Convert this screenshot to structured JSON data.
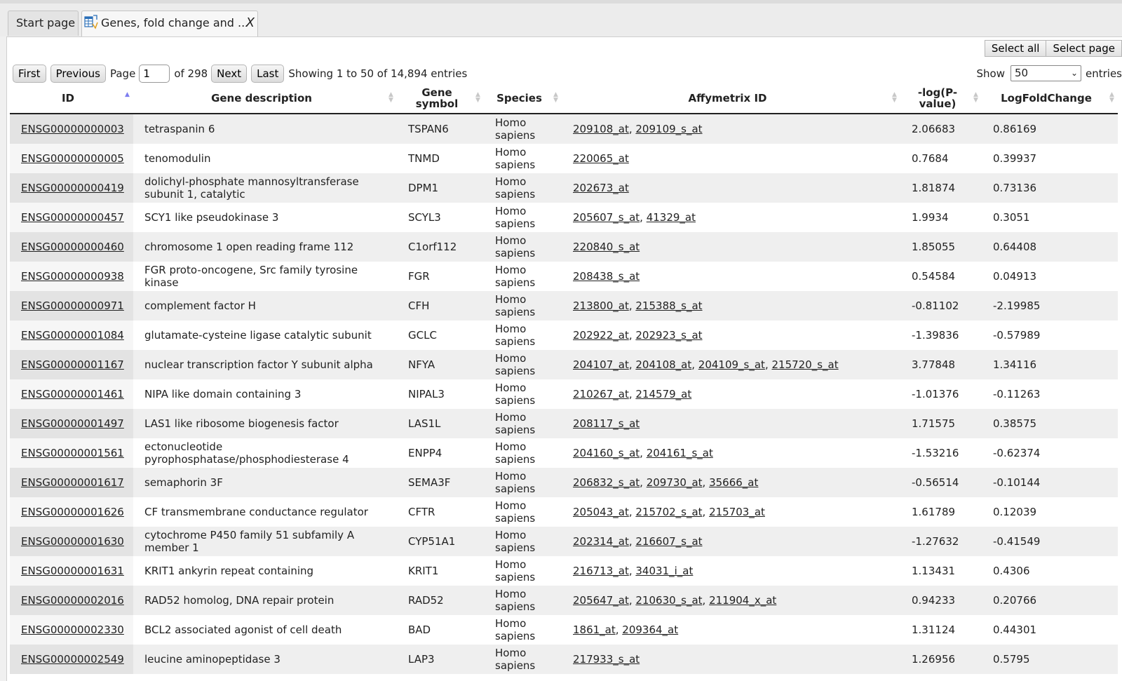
{
  "tabs": [
    {
      "label": "Start page"
    },
    {
      "label": "Genes, fold change and ...",
      "close": "X",
      "icon": "table-icon"
    }
  ],
  "toolbar": {
    "select_all": "Select all",
    "select_page": "Select page"
  },
  "pager": {
    "first": "First",
    "previous": "Previous",
    "page_label": "Page",
    "page_value": "1",
    "of_label": "of 298",
    "next": "Next",
    "last": "Last",
    "showing": "Showing 1 to 50 of 14,894 entries"
  },
  "show": {
    "label": "Show",
    "value": "50",
    "suffix": "entries"
  },
  "columns": [
    "ID",
    "Gene description",
    "Gene symbol",
    "Species",
    "Affymetrix ID",
    "-log(P-value)",
    "LogFoldChange"
  ],
  "rows": [
    {
      "id": "ENSG00000000003",
      "desc": "tetraspanin 6",
      "symbol": "TSPAN6",
      "species": "Homo sapiens",
      "affy": [
        "209108_at",
        "209109_s_at"
      ],
      "logp": "2.06683",
      "lfc": "0.86169"
    },
    {
      "id": "ENSG00000000005",
      "desc": "tenomodulin",
      "symbol": "TNMD",
      "species": "Homo sapiens",
      "affy": [
        "220065_at"
      ],
      "logp": "0.7684",
      "lfc": "0.39937"
    },
    {
      "id": "ENSG00000000419",
      "desc": "dolichyl-phosphate mannosyltransferase subunit 1, catalytic",
      "symbol": "DPM1",
      "species": "Homo sapiens",
      "affy": [
        "202673_at"
      ],
      "logp": "1.81874",
      "lfc": "0.73136"
    },
    {
      "id": "ENSG00000000457",
      "desc": "SCY1 like pseudokinase 3",
      "symbol": "SCYL3",
      "species": "Homo sapiens",
      "affy": [
        "205607_s_at",
        "41329_at"
      ],
      "logp": "1.9934",
      "lfc": "0.3051"
    },
    {
      "id": "ENSG00000000460",
      "desc": "chromosome 1 open reading frame 112",
      "symbol": "C1orf112",
      "species": "Homo sapiens",
      "affy": [
        "220840_s_at"
      ],
      "logp": "1.85055",
      "lfc": "0.64408"
    },
    {
      "id": "ENSG00000000938",
      "desc": "FGR proto-oncogene, Src family tyrosine kinase",
      "symbol": "FGR",
      "species": "Homo sapiens",
      "affy": [
        "208438_s_at"
      ],
      "logp": "0.54584",
      "lfc": "0.04913"
    },
    {
      "id": "ENSG00000000971",
      "desc": "complement factor H",
      "symbol": "CFH",
      "species": "Homo sapiens",
      "affy": [
        "213800_at",
        "215388_s_at"
      ],
      "logp": "-0.81102",
      "lfc": "-2.19985"
    },
    {
      "id": "ENSG00000001084",
      "desc": "glutamate-cysteine ligase catalytic subunit",
      "symbol": "GCLC",
      "species": "Homo sapiens",
      "affy": [
        "202922_at",
        "202923_s_at"
      ],
      "logp": "-1.39836",
      "lfc": "-0.57989"
    },
    {
      "id": "ENSG00000001167",
      "desc": "nuclear transcription factor Y subunit alpha",
      "symbol": "NFYA",
      "species": "Homo sapiens",
      "affy": [
        "204107_at",
        "204108_at",
        "204109_s_at",
        "215720_s_at"
      ],
      "logp": "3.77848",
      "lfc": "1.34116"
    },
    {
      "id": "ENSG00000001461",
      "desc": "NIPA like domain containing 3",
      "symbol": "NIPAL3",
      "species": "Homo sapiens",
      "affy": [
        "210267_at",
        "214579_at"
      ],
      "logp": "-1.01376",
      "lfc": "-0.11263"
    },
    {
      "id": "ENSG00000001497",
      "desc": "LAS1 like ribosome biogenesis factor",
      "symbol": "LAS1L",
      "species": "Homo sapiens",
      "affy": [
        "208117_s_at"
      ],
      "logp": "1.71575",
      "lfc": "0.38575"
    },
    {
      "id": "ENSG00000001561",
      "desc": "ectonucleotide pyrophosphatase/phosphodiesterase 4",
      "symbol": "ENPP4",
      "species": "Homo sapiens",
      "affy": [
        "204160_s_at",
        "204161_s_at"
      ],
      "logp": "-1.53216",
      "lfc": "-0.62374"
    },
    {
      "id": "ENSG00000001617",
      "desc": "semaphorin 3F",
      "symbol": "SEMA3F",
      "species": "Homo sapiens",
      "affy": [
        "206832_s_at",
        "209730_at",
        "35666_at"
      ],
      "logp": "-0.56514",
      "lfc": "-0.10144"
    },
    {
      "id": "ENSG00000001626",
      "desc": "CF transmembrane conductance regulator",
      "symbol": "CFTR",
      "species": "Homo sapiens",
      "affy": [
        "205043_at",
        "215702_s_at",
        "215703_at"
      ],
      "logp": "1.61789",
      "lfc": "0.12039"
    },
    {
      "id": "ENSG00000001630",
      "desc": "cytochrome P450 family 51 subfamily A member 1",
      "symbol": "CYP51A1",
      "species": "Homo sapiens",
      "affy": [
        "202314_at",
        "216607_s_at"
      ],
      "logp": "-1.27632",
      "lfc": "-0.41549"
    },
    {
      "id": "ENSG00000001631",
      "desc": "KRIT1 ankyrin repeat containing",
      "symbol": "KRIT1",
      "species": "Homo sapiens",
      "affy": [
        "216713_at",
        "34031_i_at"
      ],
      "logp": "1.13431",
      "lfc": "0.4306"
    },
    {
      "id": "ENSG00000002016",
      "desc": "RAD52 homolog, DNA repair protein",
      "symbol": "RAD52",
      "species": "Homo sapiens",
      "affy": [
        "205647_at",
        "210630_s_at",
        "211904_x_at"
      ],
      "logp": "0.94233",
      "lfc": "0.20766"
    },
    {
      "id": "ENSG00000002330",
      "desc": "BCL2 associated agonist of cell death",
      "symbol": "BAD",
      "species": "Homo sapiens",
      "affy": [
        "1861_at",
        "209364_at"
      ],
      "logp": "1.31124",
      "lfc": "0.44301"
    },
    {
      "id": "ENSG00000002549",
      "desc": "leucine aminopeptidase 3",
      "symbol": "LAP3",
      "species": "Homo sapiens",
      "affy": [
        "217933_s_at"
      ],
      "logp": "1.26956",
      "lfc": "0.5795"
    }
  ]
}
